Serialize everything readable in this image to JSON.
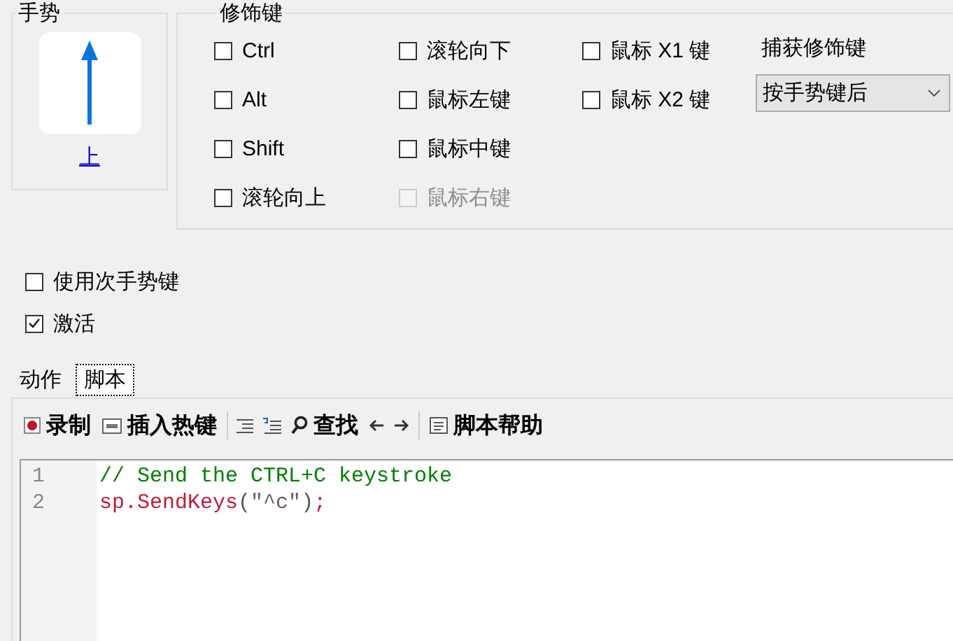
{
  "gesture": {
    "title": "手势",
    "label": "上"
  },
  "modifiers": {
    "title": "修饰键",
    "columns": [
      [
        {
          "label": "Ctrl",
          "checked": false,
          "disabled": false
        },
        {
          "label": "Alt",
          "checked": false,
          "disabled": false
        },
        {
          "label": "Shift",
          "checked": false,
          "disabled": false
        },
        {
          "label": "滚轮向上",
          "checked": false,
          "disabled": false
        }
      ],
      [
        {
          "label": "滚轮向下",
          "checked": false,
          "disabled": false
        },
        {
          "label": "鼠标左键",
          "checked": false,
          "disabled": false
        },
        {
          "label": "鼠标中键",
          "checked": false,
          "disabled": false
        },
        {
          "label": "鼠标右键",
          "checked": false,
          "disabled": true
        }
      ],
      [
        {
          "label": "鼠标 X1 键",
          "checked": false,
          "disabled": false
        },
        {
          "label": "鼠标 X2 键",
          "checked": false,
          "disabled": false
        }
      ]
    ],
    "capture": {
      "label": "捕获修饰键",
      "value": "按手势键后"
    }
  },
  "options": [
    {
      "label": "使用次手势键",
      "checked": false
    },
    {
      "label": "激活",
      "checked": true
    }
  ],
  "tabs": [
    {
      "label": "动作",
      "selected": false
    },
    {
      "label": "脚本",
      "selected": true
    }
  ],
  "toolbar": [
    {
      "kind": "record",
      "label": "录制"
    },
    {
      "kind": "hotkey",
      "label": "插入热键"
    },
    {
      "kind": "separator"
    },
    {
      "kind": "indent"
    },
    {
      "kind": "comment"
    },
    {
      "kind": "find",
      "label": "查找"
    },
    {
      "kind": "back"
    },
    {
      "kind": "forward"
    },
    {
      "kind": "separator"
    },
    {
      "kind": "help",
      "label": "脚本帮助"
    }
  ],
  "editor": {
    "lines": [
      {
        "number": "1",
        "tokens": [
          {
            "kind": "comment",
            "text": "// Send the CTRL+C keystroke"
          }
        ]
      },
      {
        "number": "2",
        "tokens": [
          {
            "kind": "code",
            "text": "sp.SendKeys"
          },
          {
            "kind": "punct",
            "text": "("
          },
          {
            "kind": "string",
            "text": "\"^c\""
          },
          {
            "kind": "punct",
            "text": ")"
          },
          {
            "kind": "code",
            "text": ";"
          }
        ]
      }
    ]
  }
}
